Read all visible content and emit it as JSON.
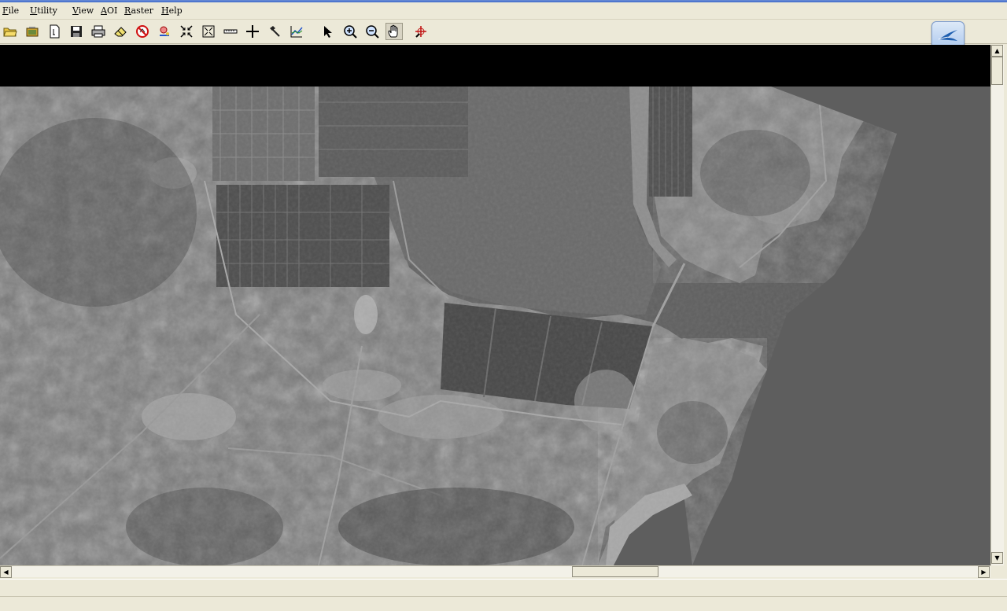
{
  "menubar": {
    "items": [
      {
        "label": "File"
      },
      {
        "label": "Utility"
      },
      {
        "label": "View"
      },
      {
        "label": "AOI"
      },
      {
        "label": "Raster"
      },
      {
        "label": "Help"
      }
    ]
  },
  "toolbar": {
    "tools": [
      {
        "icon": "open-folder-icon"
      },
      {
        "icon": "open-layer-icon"
      },
      {
        "icon": "new-document-icon"
      },
      {
        "icon": "save-icon"
      },
      {
        "icon": "print-icon"
      },
      {
        "icon": "eraser-icon"
      },
      {
        "icon": "clear-view-icon"
      },
      {
        "icon": "inquire-cursor-icon"
      },
      {
        "icon": "fit-to-window-icon"
      },
      {
        "icon": "zoom-extent-icon"
      },
      {
        "icon": "measure-ruler-icon"
      },
      {
        "icon": "crosshair-icon"
      },
      {
        "icon": "tools-hammer-icon"
      },
      {
        "icon": "chart-profile-icon"
      },
      {
        "icon": "select-arrow-icon"
      },
      {
        "icon": "zoom-in-icon"
      },
      {
        "icon": "zoom-out-icon"
      },
      {
        "icon": "pan-hand-icon",
        "pressed": true
      },
      {
        "icon": "inquire-box-icon"
      }
    ],
    "app_badge_icon": "swallow-logo-icon"
  },
  "viewer": {
    "content": "grayscale satellite image of coastal bay with salt pans and bridge",
    "colors": {
      "water": "#5f5f5f",
      "land": "#7d7d7d",
      "background": "#000000"
    }
  },
  "scrollbars": {
    "vertical_position": 0.0,
    "horizontal_position": 0.6
  }
}
